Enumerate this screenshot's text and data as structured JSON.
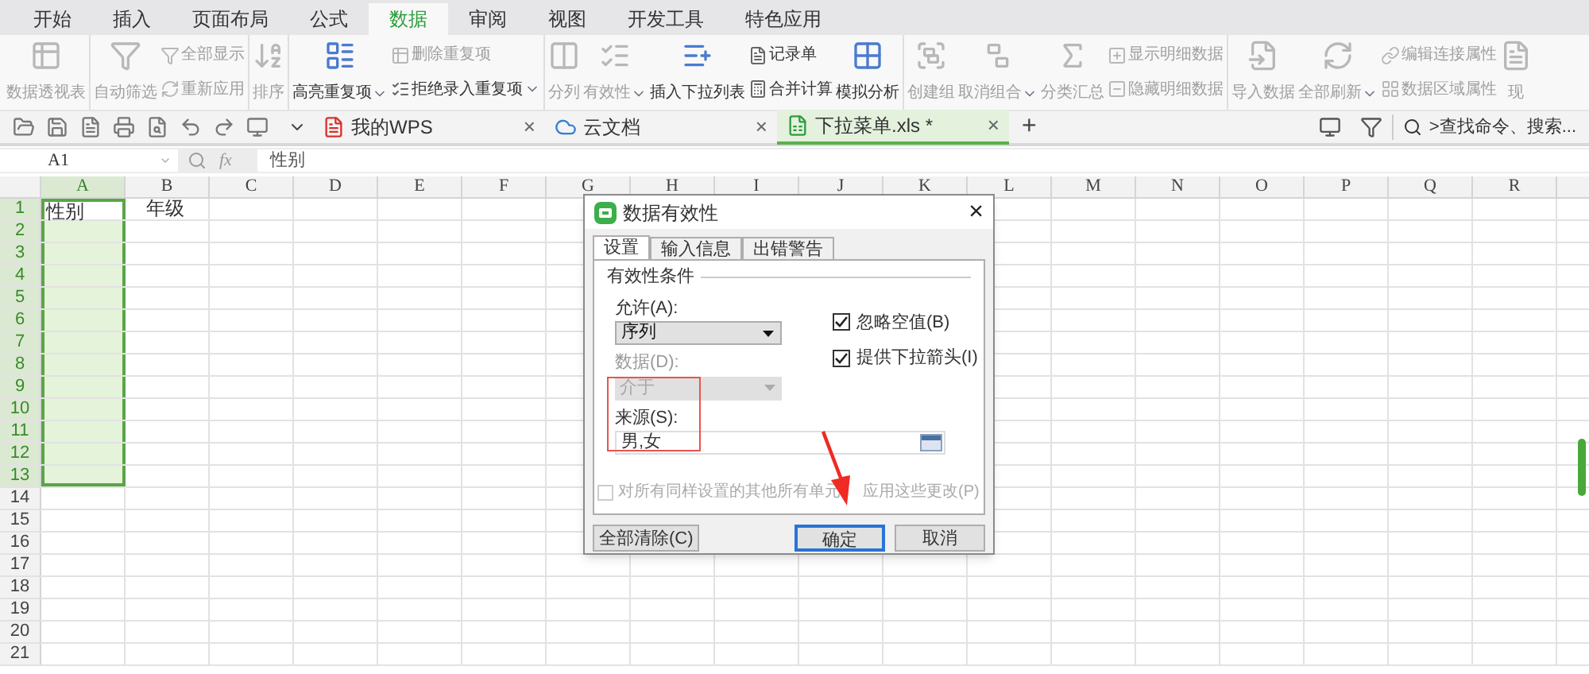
{
  "ribbon_tabs": [
    {
      "label": "开始",
      "selected": false
    },
    {
      "label": "插入",
      "selected": false
    },
    {
      "label": "页面布局",
      "selected": false
    },
    {
      "label": "公式",
      "selected": false
    },
    {
      "label": "数据",
      "selected": true
    },
    {
      "label": "审阅",
      "selected": false
    },
    {
      "label": "视图",
      "selected": false
    },
    {
      "label": "开发工具",
      "selected": false
    },
    {
      "label": "特色应用",
      "selected": false
    }
  ],
  "ribbon_groups": [
    {
      "items": [
        {
          "kind": "large",
          "label": "数据透视表",
          "disabled": true
        }
      ]
    },
    {
      "items": [
        {
          "kind": "large",
          "label": "自动筛选",
          "disabled": true
        },
        {
          "kind": "stack",
          "rows": [
            {
              "label": "全部显示",
              "disabled": true
            },
            {
              "label": "重新应用",
              "disabled": true
            }
          ]
        }
      ]
    },
    {
      "items": [
        {
          "kind": "large",
          "label": "排序",
          "disabled": true
        }
      ]
    },
    {
      "items": [
        {
          "kind": "large",
          "label": "高亮重复项",
          "disabled": false,
          "dropdown": true
        },
        {
          "kind": "stack",
          "rows": [
            {
              "label": "删除重复项",
              "disabled": true
            },
            {
              "label": "拒绝录入重复项",
              "disabled": false,
              "dropdown": true
            }
          ]
        }
      ]
    },
    {
      "items": [
        {
          "kind": "large",
          "label": "分列",
          "disabled": true
        },
        {
          "kind": "large",
          "label": "有效性",
          "disabled": true,
          "dropdown": true
        },
        {
          "kind": "large",
          "label": "插入下拉列表",
          "disabled": false
        },
        {
          "kind": "stack",
          "rows": [
            {
              "label": "记录单",
              "disabled": false
            },
            {
              "label": "合并计算",
              "disabled": false
            }
          ]
        },
        {
          "kind": "large",
          "label": "模拟分析",
          "disabled": false
        }
      ]
    },
    {
      "items": [
        {
          "kind": "large",
          "label": "创建组",
          "disabled": true
        },
        {
          "kind": "large",
          "label": "取消组合",
          "disabled": true,
          "dropdown": true
        },
        {
          "kind": "large",
          "label": "分类汇总",
          "disabled": true
        },
        {
          "kind": "stack",
          "rows": [
            {
              "label": "显示明细数据",
              "disabled": true
            },
            {
              "label": "隐藏明细数据",
              "disabled": true
            }
          ]
        }
      ]
    },
    {
      "items": [
        {
          "kind": "large",
          "label": "导入数据",
          "disabled": true
        },
        {
          "kind": "large",
          "label": "全部刷新",
          "disabled": true,
          "dropdown": true
        },
        {
          "kind": "stack",
          "rows": [
            {
              "label": "编辑连接属性",
              "disabled": true
            },
            {
              "label": "数据区域属性",
              "disabled": true
            }
          ]
        },
        {
          "kind": "large",
          "label": "现",
          "disabled": true
        }
      ]
    }
  ],
  "doc_tabs": [
    {
      "label": "我的WPS",
      "selected": false,
      "close": "×"
    },
    {
      "label": "云文档",
      "selected": false,
      "close": "×"
    },
    {
      "label": "下拉菜单.xls *",
      "selected": true,
      "close": "×"
    }
  ],
  "new_tab": "+",
  "search": {
    "placeholder": ">查找命令、搜索..."
  },
  "formula_bar": {
    "cell_ref": "A1",
    "fx": "fx",
    "value": "性别"
  },
  "columns": [
    {
      "label": "A",
      "selected": true
    },
    {
      "label": "B",
      "selected": false
    },
    {
      "label": "C",
      "selected": false
    },
    {
      "label": "D",
      "selected": false
    },
    {
      "label": "E",
      "selected": false
    },
    {
      "label": "F",
      "selected": false
    },
    {
      "label": "G",
      "selected": false
    },
    {
      "label": "H",
      "selected": false
    },
    {
      "label": "I",
      "selected": false
    },
    {
      "label": "J",
      "selected": false
    },
    {
      "label": "K",
      "selected": false
    },
    {
      "label": "L",
      "selected": false
    },
    {
      "label": "M",
      "selected": false
    },
    {
      "label": "N",
      "selected": false
    },
    {
      "label": "O",
      "selected": false
    },
    {
      "label": "P",
      "selected": false
    },
    {
      "label": "Q",
      "selected": false
    },
    {
      "label": "R",
      "selected": false
    }
  ],
  "rows": [
    {
      "label": "1",
      "selected": true,
      "cells": [
        "性别",
        "年级"
      ]
    },
    {
      "label": "2",
      "selected": true
    },
    {
      "label": "3",
      "selected": true
    },
    {
      "label": "4",
      "selected": true
    },
    {
      "label": "5",
      "selected": true
    },
    {
      "label": "6",
      "selected": true
    },
    {
      "label": "7",
      "selected": true
    },
    {
      "label": "8",
      "selected": true
    },
    {
      "label": "9",
      "selected": true
    },
    {
      "label": "10",
      "selected": true
    },
    {
      "label": "11",
      "selected": true
    },
    {
      "label": "12",
      "selected": true
    },
    {
      "label": "13",
      "selected": true
    },
    {
      "label": "14",
      "selected": false
    },
    {
      "label": "15",
      "selected": false
    },
    {
      "label": "16",
      "selected": false
    },
    {
      "label": "17",
      "selected": false
    },
    {
      "label": "18",
      "selected": false
    },
    {
      "label": "19",
      "selected": false
    },
    {
      "label": "20",
      "selected": false
    },
    {
      "label": "21",
      "selected": false
    }
  ],
  "dialog": {
    "title": "数据有效性",
    "close": "×",
    "tabs": [
      {
        "label": "设置",
        "selected": true
      },
      {
        "label": "输入信息",
        "selected": false
      },
      {
        "label": "出错警告",
        "selected": false
      }
    ],
    "section": "有效性条件",
    "allow": {
      "label": "允许(A):",
      "value": "序列",
      "disabled": false
    },
    "data": {
      "label": "数据(D):",
      "value": "介于",
      "disabled": true
    },
    "checkboxes": [
      {
        "label": "忽略空值(B)",
        "checked": true,
        "disabled": false
      },
      {
        "label": "提供下拉箭头(I)",
        "checked": true,
        "disabled": false
      }
    ],
    "source": {
      "label": "来源(S):",
      "value": "男,女"
    },
    "apply_all": {
      "label": "对所有同样设置的其他所有单元",
      "label_after": "应用这些更改(P)",
      "checked": false,
      "disabled": true
    },
    "buttons": [
      {
        "label": "全部清除(C)",
        "kind": "left",
        "focused": false
      },
      {
        "label": "确定",
        "kind": "right",
        "focused": true
      },
      {
        "label": "取消",
        "kind": "right",
        "focused": false
      }
    ]
  }
}
